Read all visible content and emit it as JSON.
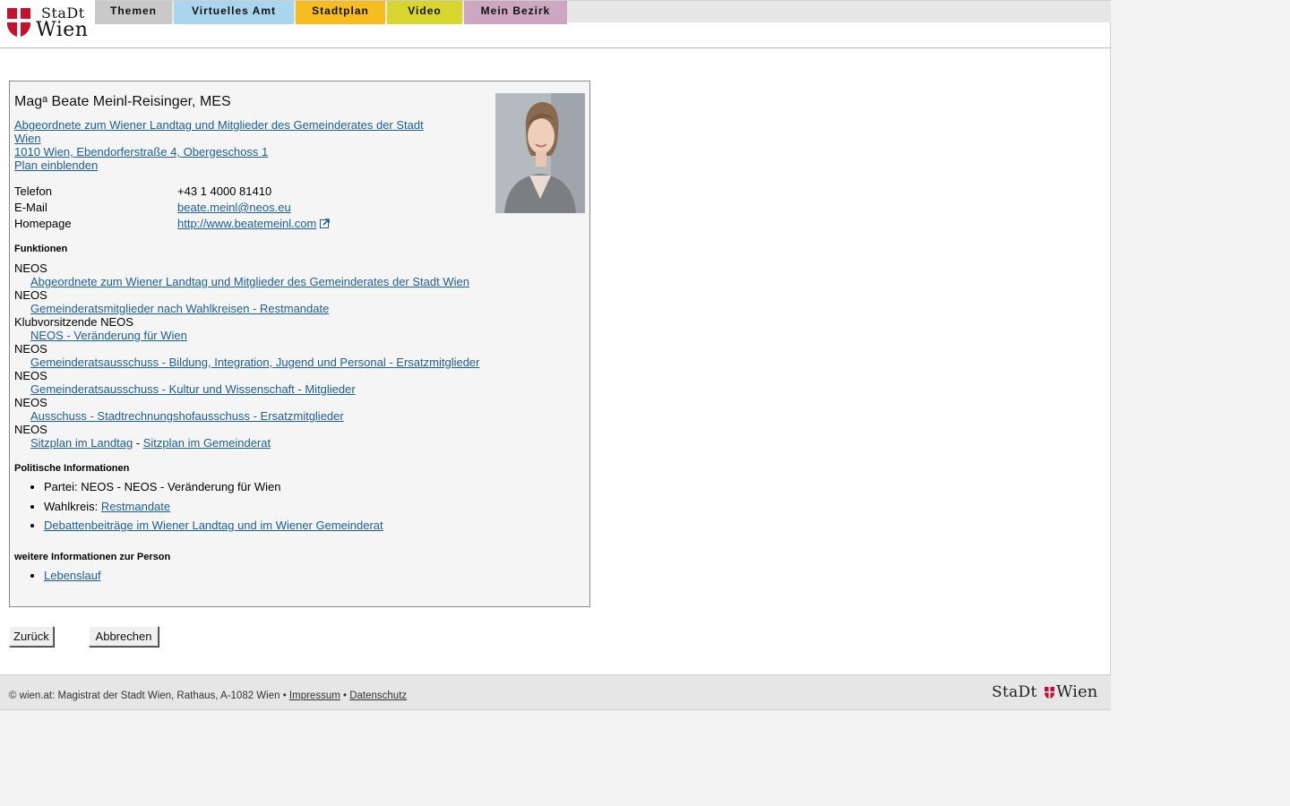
{
  "header": {
    "logo_stadt": "StaDt",
    "logo_wien": "Wien",
    "nav": [
      {
        "label": "Themen",
        "color": "#c9c9c9"
      },
      {
        "label": "Virtuelles Amt",
        "color": "#a9d5ef"
      },
      {
        "label": "Stadtplan",
        "color": "#f5bd1f"
      },
      {
        "label": "Video",
        "color": "#d8d52e"
      },
      {
        "label": "Mein Bezirk",
        "color": "#cda6c2"
      }
    ]
  },
  "person": {
    "name": "Magᵃ Beate Meinl-Reisinger, MES",
    "role": "Abgeordnete zum Wiener Landtag und Mitglieder des Gemeinderates der Stadt Wien ",
    "address": "1010 Wien, Ebendorferstraße 4, Obergeschoss 1",
    "plan_link": "Plan einblenden"
  },
  "contact": {
    "phone_label": "Telefon",
    "phone": "+43 1 4000 81410",
    "email_label": "E-Mail",
    "email": "beate.meinl@neos.eu",
    "homepage_label": "Homepage",
    "homepage": "http://www.beatemeinl.com"
  },
  "functions": {
    "title": "Funktionen",
    "items": [
      {
        "org": "NEOS",
        "link": "Abgeordnete zum Wiener Landtag und Mitglieder des Gemeinderates der Stadt Wien"
      },
      {
        "org": "NEOS",
        "link": "Gemeinderatsmitglieder nach Wahlkreisen - Restmandate"
      },
      {
        "org": "Klubvorsitzende NEOS",
        "link": "NEOS - Veränderung für Wien"
      },
      {
        "org": "NEOS",
        "link": "Gemeinderatsausschuss - Bildung, Integration, Jugend und Personal - Ersatzmitglieder"
      },
      {
        "org": "NEOS",
        "link": "Gemeinderatsausschuss - Kultur und Wissenschaft - Mitglieder"
      },
      {
        "org": "NEOS",
        "link": "Ausschuss - Stadtrechnungshofausschuss - Ersatzmitglieder"
      }
    ],
    "last_org": "NEOS",
    "seat_landtag": "Sitzplan im Landtag",
    "seat_separator": " - ",
    "seat_gemeinderat": "Sitzplan im Gemeinderat"
  },
  "political": {
    "title": "Politische Informationen",
    "party_label": "Partei: ",
    "party": "NEOS - NEOS - Veränderung für Wien",
    "district_label": "Wahlkreis: ",
    "district": "Restmandate",
    "debates": "Debattenbeiträge im Wiener Landtag und im Wiener Gemeinderat"
  },
  "more": {
    "title": "weitere Informationen zur Person",
    "cv": "Lebenslauf"
  },
  "buttons": {
    "back": "Zurück",
    "cancel": "Abbrechen"
  },
  "footer": {
    "text": "© wien.at: Magistrat der Stadt Wien, Rathaus, A-1082 Wien • ",
    "impressum": "Impressum",
    "separator": " • ",
    "datenschutz": "Datenschutz",
    "logo_stadt": "StaDt",
    "logo_wien": "Wien"
  },
  "colors": {
    "link": "#1a5e9a",
    "wien_red": "#c8102e"
  }
}
